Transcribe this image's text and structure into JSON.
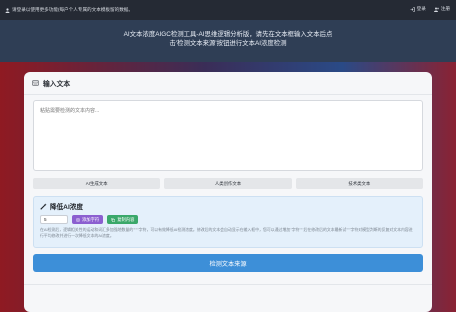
{
  "topbar": {
    "notice": "请登录以使用更多功能(每户个人专属的文本模板留的数据。",
    "login_label": "登录",
    "register_label": "注册"
  },
  "hero": {
    "line1": "AI文本浓度AIGC检测工具-AI思维逻辑分析版，请先在文本框输入文本后点",
    "line2": "击'检测文本来源'按钮进行文本AI浓度检测"
  },
  "input_section": {
    "title": "输入文本",
    "placeholder": "粘贴需要检测的文本内容...",
    "samples": [
      "AI生成文本",
      "人类创作文本",
      "技术类文本"
    ]
  },
  "reduce_section": {
    "title": "降低AI浓度",
    "count_value": "5",
    "add_button": "添加字符",
    "copy_button": "复制内容",
    "description": "在AI检测后，逻辑相关性的运动和词汇多加强地数量的\"\"\"\"字符，可以有效降低AI检测浓度。修改后的文本会自动显示在输入框中，您可以通过增加\"字符\"\"\"后在修改后的文本最新试\"\"\"字符对模型判断的反复对文本内容进行平均修改并进行一次降低文本的AI浓度。"
  },
  "detect_button": "检测文本来源",
  "colors": {
    "topbar": "#252a34",
    "hero": "#2f3e55",
    "primary": "#3d8fd8",
    "purple": "#8b5fd0",
    "green": "#3aa86a"
  }
}
